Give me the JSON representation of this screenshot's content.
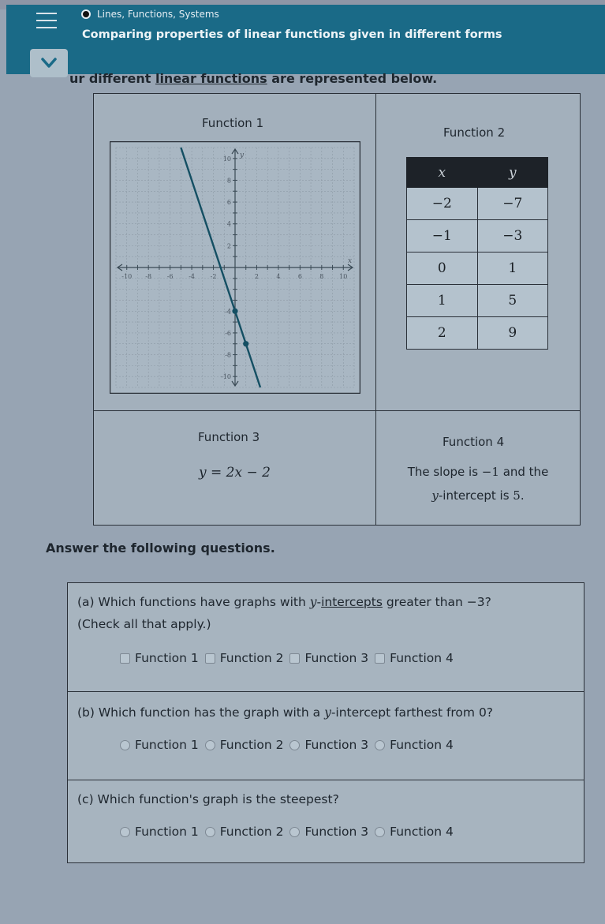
{
  "header": {
    "topic": "Lines, Functions, Systems",
    "title": "Comparing properties of linear functions given in different forms"
  },
  "intro": {
    "prefix": "ur different ",
    "link": "linear functions",
    "suffix": " are represented below."
  },
  "functions": {
    "f1": {
      "label": "Function 1",
      "graph": {
        "x_label": "x",
        "y_label": "y",
        "x_ticks": [
          "-10",
          "-8",
          "-6",
          "-4",
          "-2",
          "2",
          "4",
          "6",
          "8",
          "10"
        ],
        "y_ticks": [
          "10",
          "8",
          "6",
          "4",
          "2",
          "-4",
          "-6",
          "-8",
          "-10"
        ],
        "xlim": [
          -10,
          10
        ],
        "ylim": [
          -10,
          10
        ],
        "points": [
          [
            0,
            -4
          ],
          [
            1,
            -7
          ]
        ],
        "slope": -3,
        "intercept": -4
      }
    },
    "f2": {
      "label": "Function 2",
      "columns": [
        "x",
        "y"
      ],
      "rows": [
        [
          "−2",
          "−7"
        ],
        [
          "−1",
          "−3"
        ],
        [
          "0",
          "1"
        ],
        [
          "1",
          "5"
        ],
        [
          "2",
          "9"
        ]
      ]
    },
    "f3": {
      "label": "Function 3",
      "equation": "y = 2x − 2"
    },
    "f4": {
      "label": "Function 4",
      "line1_pre": "The slope is ",
      "line1_val": "−1",
      "line1_post": " and the",
      "line2_var": "y",
      "line2_post": "-intercept is ",
      "line2_val": "5",
      "line2_end": "."
    }
  },
  "answer_heading": "Answer the following questions.",
  "questions": {
    "a": {
      "pre": "(a) Which functions have graphs with ",
      "var": "y",
      "dash": "-",
      "link": "intercepts",
      "post": " greater than −3?",
      "line2": "(Check all that apply.)",
      "options": [
        "Function 1",
        "Function 2",
        "Function 3",
        "Function 4"
      ]
    },
    "b": {
      "pre": "(b) Which function has the graph with a ",
      "var": "y",
      "post": "-intercept farthest from 0?",
      "options": [
        "Function 1",
        "Function 2",
        "Function 3",
        "Function 4"
      ]
    },
    "c": {
      "text": "(c) Which function's graph is the steepest?",
      "options": [
        "Function 1",
        "Function 2",
        "Function 3",
        "Function 4"
      ]
    }
  },
  "colors": {
    "header_bg": "#1a6a87",
    "line": "#144f63"
  }
}
